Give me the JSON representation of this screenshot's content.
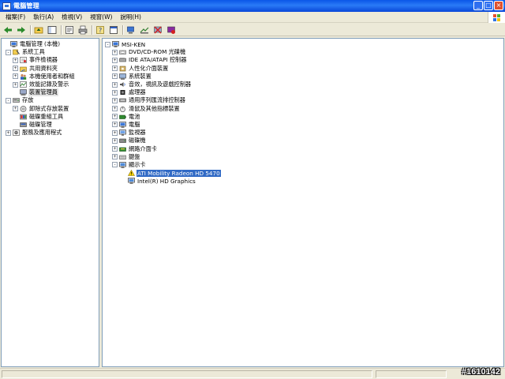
{
  "window": {
    "title": "電腦管理"
  },
  "menu": [
    "檔案(F)",
    "執行(A)",
    "檢視(V)",
    "視窗(W)",
    "說明(H)"
  ],
  "toolbar_icons": [
    "back-arrow-icon",
    "forward-arrow-icon",
    "up-folder-icon",
    "show-hide-tree-icon",
    "properties-icon",
    "print-icon",
    "help-icon",
    "console-tree-icon",
    "scan-hardware-icon",
    "update-driver-icon",
    "uninstall-icon",
    "disable-icon"
  ],
  "left_tree": {
    "root": "電腦管理 (本機)",
    "groups": [
      {
        "label": "系統工具",
        "expanded": true,
        "items": [
          {
            "label": "事件檢視器",
            "has_children": true
          },
          {
            "label": "共用資料夾",
            "has_children": true
          },
          {
            "label": "本機使用者和群組",
            "has_children": true
          },
          {
            "label": "效能記錄及警示",
            "has_children": true
          },
          {
            "label": "裝置管理員",
            "has_children": false,
            "selected": true
          }
        ]
      },
      {
        "label": "存放",
        "expanded": true,
        "items": [
          {
            "label": "卸除式存放裝置",
            "has_children": true
          },
          {
            "label": "磁碟重組工具",
            "has_children": false
          },
          {
            "label": "磁碟管理",
            "has_children": false
          }
        ]
      },
      {
        "label": "服務及應用程式",
        "expanded": false,
        "items": []
      }
    ]
  },
  "device_tree": {
    "root": "MSI-KEN",
    "categories": [
      {
        "label": "DVD/CD-ROM 光碟機",
        "icon": "cdrom-icon"
      },
      {
        "label": "IDE ATA/ATAPI 控制器",
        "icon": "ide-controller-icon"
      },
      {
        "label": "人性化介面裝置",
        "icon": "hid-icon"
      },
      {
        "label": "系統裝置",
        "icon": "system-device-icon"
      },
      {
        "label": "音效，視訊及遊戲控制器",
        "icon": "sound-icon"
      },
      {
        "label": "處理器",
        "icon": "processor-icon"
      },
      {
        "label": "通用序列匯流排控制器",
        "icon": "usb-icon"
      },
      {
        "label": "滑鼠及其他指標裝置",
        "icon": "mouse-icon"
      },
      {
        "label": "電池",
        "icon": "battery-icon"
      },
      {
        "label": "電腦",
        "icon": "computer-icon"
      },
      {
        "label": "監視器",
        "icon": "monitor-icon"
      },
      {
        "label": "磁碟機",
        "icon": "disk-drive-icon"
      },
      {
        "label": "網路介面卡",
        "icon": "network-adapter-icon"
      },
      {
        "label": "鍵盤",
        "icon": "keyboard-icon"
      },
      {
        "label": "顯示卡",
        "icon": "display-adapter-icon",
        "expanded": true,
        "children": [
          {
            "label": "ATI Mobility Radeon HD 5470",
            "selected": true,
            "warning": true
          },
          {
            "label": "Intel(R) HD Graphics",
            "selected": false,
            "warning": false
          }
        ]
      }
    ]
  },
  "watermark": "#1610142",
  "colors": {
    "title_bar": "#0a56e8",
    "selection": "#316ac5",
    "chrome": "#ece9d8"
  }
}
